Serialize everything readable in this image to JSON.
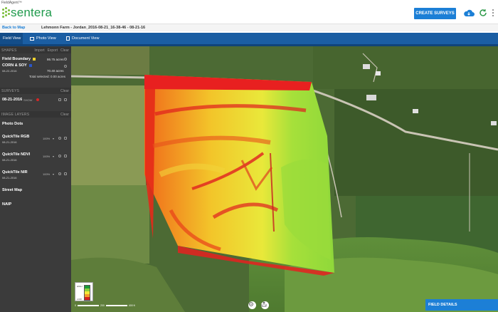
{
  "header": {
    "brand_small": "FieldAgent™",
    "logo_text": "sentera",
    "create_button": "CREATE SURVEYS",
    "icons": [
      "cloud-icon",
      "refresh-icon",
      "menu-icon"
    ]
  },
  "subheader": {
    "back_link": "Back to Map",
    "survey_title": "Lehmonn Farm - Jordan_2016-08-21_16-38-46 - 08-21-16"
  },
  "tabs": [
    {
      "label": "Field View",
      "active": true
    },
    {
      "label": "Photo View",
      "active": false
    },
    {
      "label": "Document View",
      "active": false
    }
  ],
  "sidebar": {
    "shapes": {
      "title": "SHAPES",
      "actions": [
        "Import",
        "Export",
        "Clear"
      ],
      "items": [
        {
          "name": "Field Boundary",
          "date": "",
          "acres": "86.75 acres",
          "color": "#f2d22e"
        },
        {
          "name": "CORN & SOY",
          "date": "08-22-2016",
          "acres": "70.40 acres",
          "color": "#2a56c8"
        }
      ],
      "total": "Total selected: 0.00 acres"
    },
    "surveys": {
      "title": "SURVEYS",
      "clear": "Clear",
      "items": [
        {
          "date": "08-21-2016",
          "tag": "SHOW",
          "color": "#d62828"
        }
      ]
    },
    "image_layers": {
      "title": "IMAGE LAYERS",
      "clear": "Clear",
      "items": [
        {
          "name": "Photo Dots",
          "date": "",
          "pct": ""
        },
        {
          "name": "QuickTile RGB",
          "date": "08-21-2016",
          "pct": "100%"
        },
        {
          "name": "QuickTile NDVI",
          "date": "08-21-2016",
          "pct": "100%"
        },
        {
          "name": "QuickTile NIR",
          "date": "08-21-2016",
          "pct": "100%"
        },
        {
          "name": "Street Map",
          "date": "",
          "pct": ""
        },
        {
          "name": "NAIP",
          "date": "",
          "pct": ""
        }
      ]
    }
  },
  "map": {
    "legend": {
      "high": "HIGH",
      "low": "LOW",
      "colors": [
        "#1a9a3a",
        "#8ccf3a",
        "#f4e83a",
        "#f39a2a",
        "#d62020"
      ]
    },
    "scale": [
      "0",
      "200",
      "400 ft"
    ],
    "buttons": [
      "locate-icon",
      "share-icon"
    ],
    "field_details": "FIELD DETAILS"
  }
}
